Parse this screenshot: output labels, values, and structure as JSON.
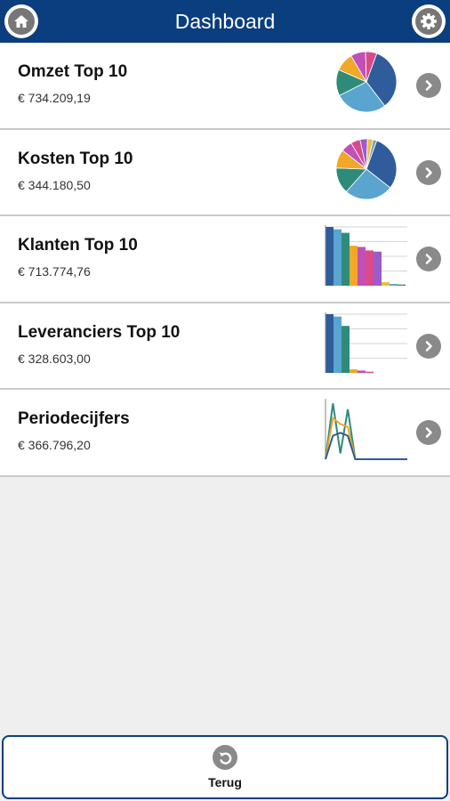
{
  "header": {
    "title": "Dashboard",
    "home_icon": "home-icon",
    "settings_icon": "gear-icon",
    "color": "#0a3e7e"
  },
  "rows": [
    {
      "title": "Omzet Top 10",
      "value": "€ 734.209,19",
      "chart": "pie"
    },
    {
      "title": "Kosten Top 10",
      "value": "€ 344.180,50",
      "chart": "pie"
    },
    {
      "title": "Klanten Top 10",
      "value": "€ 713.774,76",
      "chart": "bar"
    },
    {
      "title": "Leveranciers Top 10",
      "value": "€ 328.603,00",
      "chart": "bar"
    },
    {
      "title": "Periodecijfers",
      "value": "€ 366.796,20",
      "chart": "line"
    }
  ],
  "footer": {
    "back_label": "Terug",
    "back_icon": "undo-arrow-icon"
  },
  "chart_data": [
    {
      "type": "pie",
      "values": [
        34,
        28,
        14,
        10,
        8,
        6
      ],
      "colors": [
        "#2f5c9a",
        "#5aa5cf",
        "#2e8b7a",
        "#f0a828",
        "#c050b8",
        "#d84a8a"
      ]
    },
    {
      "type": "pie",
      "values": [
        30,
        26,
        14,
        10,
        6,
        5,
        4,
        3,
        2
      ],
      "colors": [
        "#2f5c9a",
        "#5aa5cf",
        "#2e8b7a",
        "#f0a828",
        "#c050b8",
        "#d84a8a",
        "#9a5cc8",
        "#e8c040",
        "#7aa0c0"
      ]
    },
    {
      "type": "bar",
      "values": [
        100,
        96,
        90,
        68,
        66,
        60,
        58,
        6,
        3,
        2
      ],
      "colors": [
        "#2f5c9a",
        "#5aa5cf",
        "#2e8b7a",
        "#f0a828",
        "#c050b8",
        "#d84a8a",
        "#9a5cc8",
        "#e8c040",
        "#5aa5cf",
        "#2e8b7a"
      ]
    },
    {
      "type": "bar",
      "values": [
        100,
        96,
        80,
        6,
        4,
        2
      ],
      "colors": [
        "#2f5c9a",
        "#5aa5cf",
        "#2e8b7a",
        "#f0a828",
        "#c050b8",
        "#d84a8a"
      ]
    },
    {
      "type": "line",
      "series": [
        {
          "values": [
            0,
            95,
            10,
            85,
            0,
            0,
            0,
            0,
            0,
            0,
            0,
            0
          ],
          "color": "#2e8b7a"
        },
        {
          "values": [
            0,
            70,
            60,
            55,
            0,
            0,
            0,
            0,
            0,
            0,
            0,
            0
          ],
          "color": "#f0a828"
        },
        {
          "values": [
            0,
            40,
            45,
            40,
            0,
            0,
            0,
            0,
            0,
            0,
            0,
            0
          ],
          "color": "#2f5c9a"
        }
      ]
    }
  ]
}
